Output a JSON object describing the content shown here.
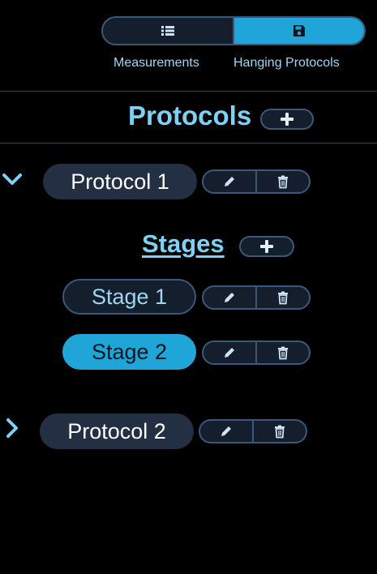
{
  "toggle": {
    "measurements_label": "Measurements",
    "hanging_protocols_label": "Hanging Protocols",
    "active": "hanging_protocols"
  },
  "protocols_section": {
    "heading": "Protocols",
    "items": [
      {
        "label": "Protocol 1",
        "expanded": true,
        "stages_heading": "Stages",
        "stages": [
          {
            "label": "Stage 1",
            "active": false
          },
          {
            "label": "Stage 2",
            "active": true
          }
        ]
      },
      {
        "label": "Protocol 2",
        "expanded": false
      }
    ]
  },
  "icons": {
    "measurements": "list-icon",
    "hanging_protocols": "save-icon",
    "add": "plus-icon",
    "edit": "pencil-icon",
    "delete": "trash-icon",
    "expanded": "chevron-down-icon",
    "collapsed": "chevron-right-icon"
  },
  "colors": {
    "background": "#000000",
    "accent": "#20a5d8",
    "heading": "#7fd0f5",
    "label": "#9dd7f3",
    "border": "#3c5878",
    "pill_dark": "#232f42",
    "control_bg": "#151e2d"
  }
}
